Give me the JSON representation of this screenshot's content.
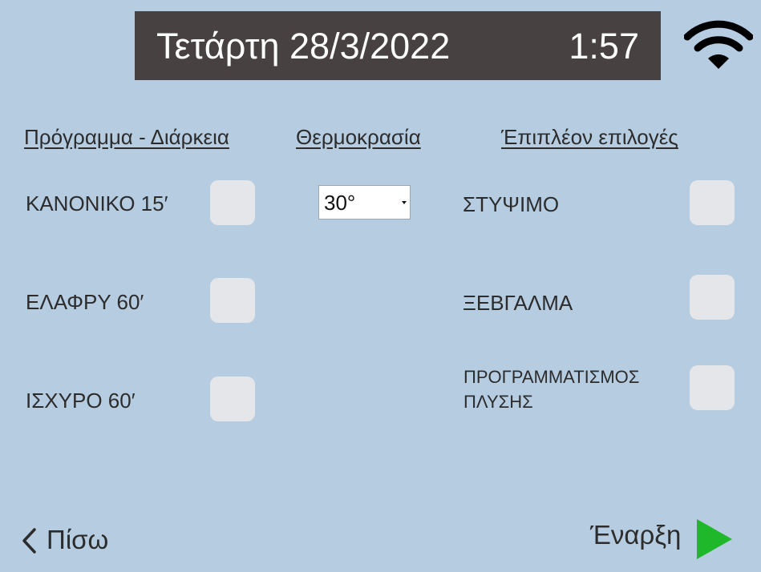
{
  "header": {
    "date": "Τετάρτη 28/3/2022",
    "time": "1:57",
    "icon": "wifi-icon"
  },
  "columns": {
    "program_heading": "Πρόγραμμα - Διάρκεια",
    "temperature_heading": "Θερμοκρασία",
    "options_heading": "Έπιπλέον επιλογές"
  },
  "programs": [
    {
      "label": "ΚΑΝΟΝΙΚΟ 15′",
      "checked": false
    },
    {
      "label": "ΕΛΑΦΡΥ 60′",
      "checked": false
    },
    {
      "label": "ΙΣΧΥΡΟ 60′",
      "checked": false
    }
  ],
  "temperature": {
    "selected": "30°"
  },
  "options": [
    {
      "label": "ΣΤΥΨΙΜΟ",
      "checked": false
    },
    {
      "label": "ΞΕΒΓΑΛΜΑ",
      "checked": false
    },
    {
      "label": "ΠΡΟΓΡΑΜΜΑΤΙΣΜΟΣ ΠΛΥΣΗΣ",
      "checked": false
    }
  ],
  "footer": {
    "back_label": "Πίσω",
    "start_label": "Έναρξη"
  },
  "colors": {
    "background": "#b6cce1",
    "header_bar": "#474241",
    "checkbox": "#e5e6ea",
    "start_accent": "#1fb82a"
  }
}
